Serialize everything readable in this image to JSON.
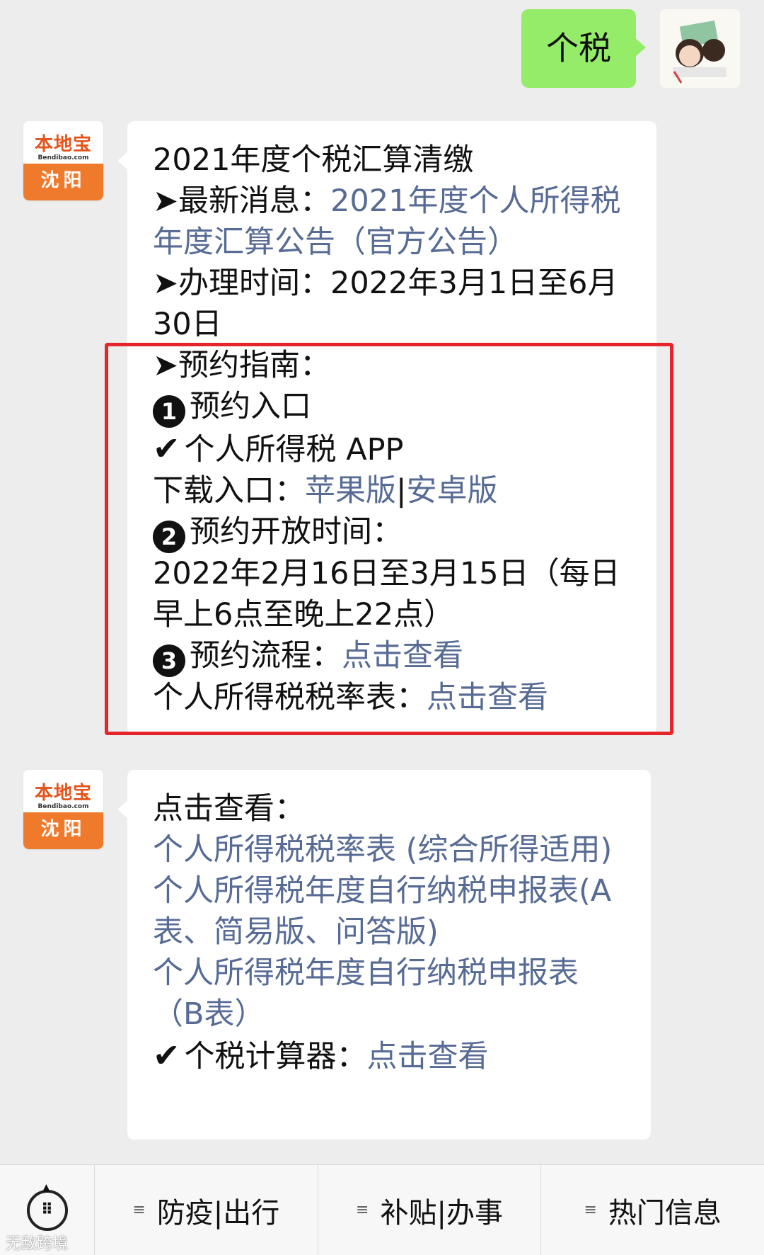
{
  "user_message": {
    "text": "个税"
  },
  "bot_avatar": {
    "logo_cn": "本地宝",
    "logo_en": "Bendibao.com",
    "city": "沈阳"
  },
  "message1": {
    "title": "2021年度个税汇算清缴",
    "news_prefix": "➤最新消息：",
    "news_link": "2021年度个人所得税年度汇算公告（官方公告）",
    "time_label": "➤办理时间：",
    "time_value": "2022年3月1日至6月30日",
    "guide_label": "➤预约指南：",
    "step1_num": "1",
    "step1_label": "预约入口",
    "app_check": "✔",
    "app_name": "个人所得税 APP",
    "download_label": "下载入口：",
    "download_apple": "苹果版",
    "download_sep": "|",
    "download_android": "安卓版",
    "step2_num": "2",
    "step2_label": "预约开放时间：",
    "step2_value": "2022年2月16日至3月15日（每日早上6点至晚上22点）",
    "step3_num": "3",
    "step3_label": "预约流程：",
    "step3_link": "点击查看",
    "rate_label": "个人所得税税率表：",
    "rate_link": "点击查看"
  },
  "message2": {
    "header": "点击查看：",
    "link1": "个人所得税税率表 (综合所得适用)",
    "link2": "个人所得税年度自行纳税申报表(A表、简易版、问答版)",
    "link3": "个人所得税年度自行纳税申报表（B表）",
    "calc_check": "✔",
    "calc_label": "个税计算器：",
    "calc_link": "点击查看"
  },
  "menu": {
    "keyboard_icon": "keyboard-icon",
    "items": [
      {
        "label": "防疫|出行"
      },
      {
        "label": "补贴|办事"
      },
      {
        "label": "热门信息"
      }
    ]
  },
  "watermark": "无敌跨境",
  "colors": {
    "link": "#576b95",
    "user_bubble": "#95ec69",
    "highlight": "#e4262a",
    "background": "#ededed"
  }
}
